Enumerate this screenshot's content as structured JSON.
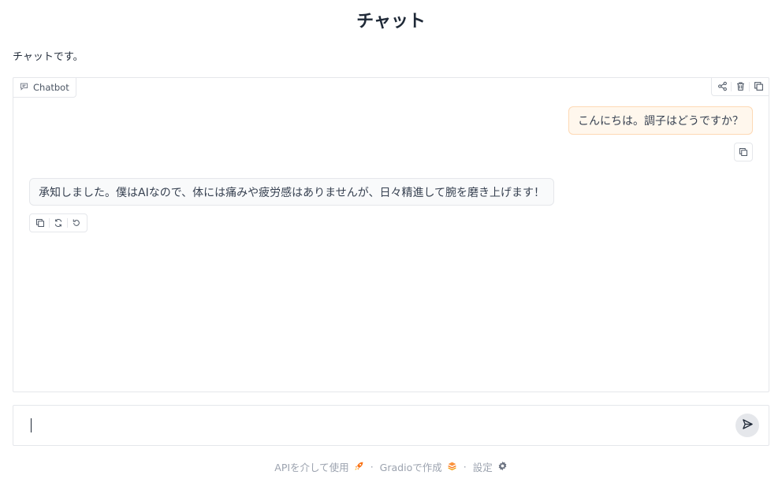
{
  "header": {
    "title": "チャット"
  },
  "description": "チャットです。",
  "chatbot": {
    "label": "Chatbot",
    "label_icon": "chat-icon",
    "top_actions": [
      "share-icon",
      "trash-icon",
      "copy-icon"
    ],
    "messages": [
      {
        "role": "user",
        "text": "こんにちは。調子はどうですか？"
      },
      {
        "role": "bot",
        "text": "承知しました。僕はAIなので、体には痛みや疲労感はありませんが、日々精進して腕を磨き上げます！"
      }
    ],
    "bot_actions": [
      "copy-icon",
      "retry-icon",
      "undo-icon"
    ]
  },
  "input": {
    "value": "",
    "placeholder": ""
  },
  "footer": {
    "api_label": "APIを介して使用",
    "gradio_label": "Gradioで作成",
    "settings_label": "設定",
    "separator": "·"
  },
  "colors": {
    "user_bubble_bg": "#fff7ed",
    "user_bubble_border": "#fdd9b5",
    "accent": "#f97316"
  }
}
